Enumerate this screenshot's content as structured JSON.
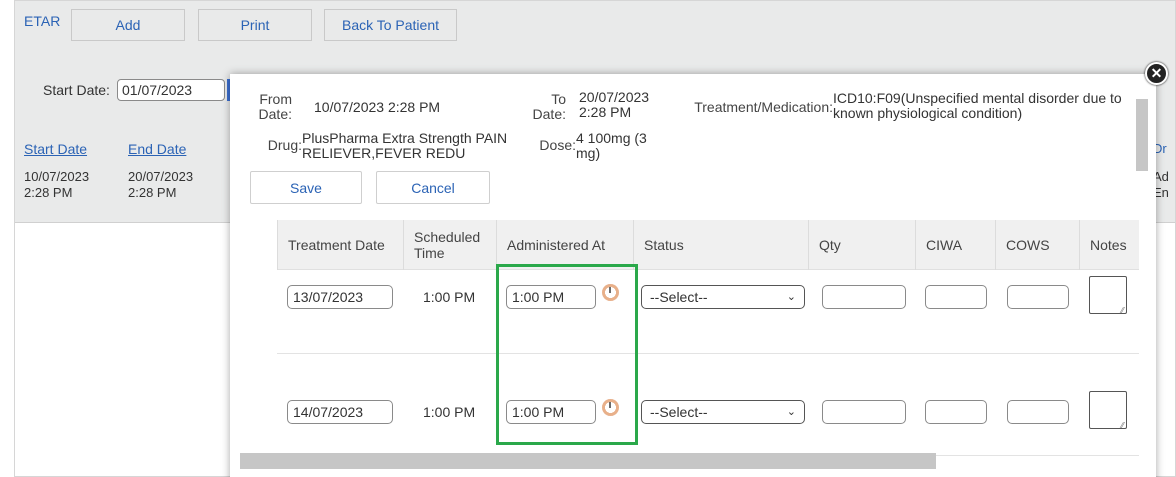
{
  "background": {
    "toolbar": {
      "title": "ETAR",
      "add_label": "Add",
      "print_label": "Print",
      "back_label": "Back To Patient"
    },
    "filter": {
      "start_date_label": "Start Date:",
      "start_date_value": "01/07/2023"
    },
    "grid": {
      "headers": [
        "Start Date",
        "End Date"
      ],
      "row": {
        "start_date": "10/07/2023 2:28 PM",
        "end_date": "20/07/2023 2:28 PM"
      },
      "right_header": "Dr",
      "right_cell": "Ad En"
    }
  },
  "modal": {
    "from_date_label": "From Date:",
    "from_date_value": "10/07/2023 2:28 PM",
    "to_date_label": "To Date:",
    "to_date_value": "20/07/2023 2:28 PM",
    "treatment_label": "Treatment/Medication:",
    "treatment_value": "ICD10:F09(Unspecified mental disorder due to known physiological condition)",
    "drug_label": "Drug:",
    "drug_value": "PlusPharma Extra Strength PAIN RELIEVER,FEVER REDU",
    "dose_label": "Dose:",
    "dose_value": "4 100mg (3 mg)",
    "save_label": "Save",
    "cancel_label": "Cancel",
    "close_icon": "close-icon",
    "table": {
      "headers": [
        "Treatment Date",
        "Scheduled Time",
        "Administered At",
        "Status",
        "Qty",
        "CIWA",
        "COWS",
        "Notes"
      ],
      "rows": [
        {
          "treatment_date": "13/07/2023",
          "scheduled_time": "1:00 PM",
          "administered_at": "1:00 PM",
          "status": "--Select--"
        },
        {
          "treatment_date": "14/07/2023",
          "scheduled_time": "1:00 PM",
          "administered_at": "1:00 PM",
          "status": "--Select--"
        }
      ]
    }
  },
  "colors": {
    "link": "#2b63b5",
    "highlight": "#2aa84a",
    "background_gray": "#e9eaea"
  }
}
